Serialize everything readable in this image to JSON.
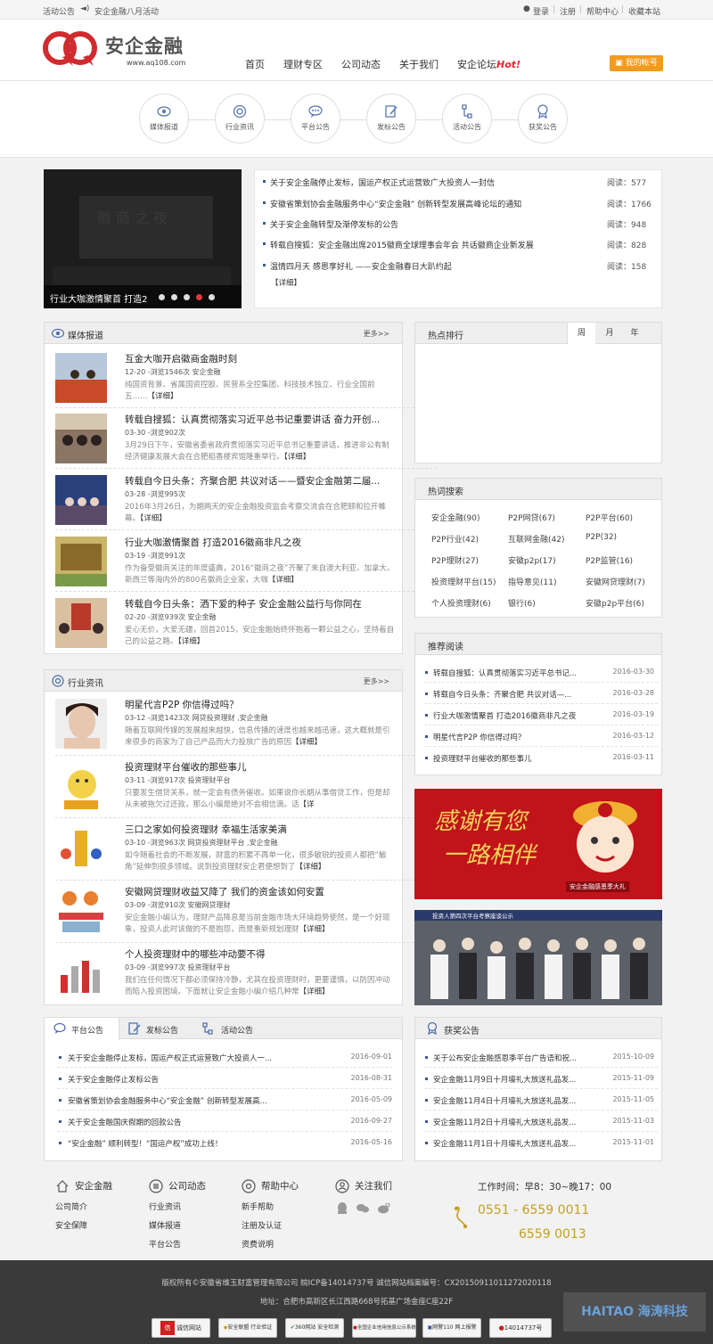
{
  "topbar": {
    "notice_label": "活动公告",
    "notice_text": "安企金融八月活动",
    "login": "登录",
    "register": "注册",
    "help": "帮助中心",
    "favorite": "收藏本站"
  },
  "brand": {
    "name": "安企金融",
    "url": "www.aq108.com",
    "accent": "#d02b2f"
  },
  "nav": {
    "items": [
      "首页",
      "理财专区",
      "公司动态",
      "关于我们",
      "安企论坛"
    ],
    "hot": "Hot!",
    "account": "我的帐号"
  },
  "categories": [
    {
      "label": "媒体报道",
      "icon": "eye-icon"
    },
    {
      "label": "行业资讯",
      "icon": "target-icon"
    },
    {
      "label": "平台公告",
      "icon": "chat-icon"
    },
    {
      "label": "发标公告",
      "icon": "edit-icon"
    },
    {
      "label": "活动公告",
      "icon": "flow-icon"
    },
    {
      "label": "获奖公告",
      "icon": "medal-icon"
    }
  ],
  "slider": {
    "caption": "行业大咖激情聚首 打造2",
    "dots": 5,
    "active_dot": 4
  },
  "top_news": {
    "items": [
      {
        "title": "关于安企金融停止发标，国运产权正式运营致广大投资人一封信",
        "views": "阅读：577"
      },
      {
        "title": "安徽省策划协会金融服务中心“安企金融” 创新转型发展高峰论坛的通知",
        "views": "阅读：1766"
      },
      {
        "title": "关于安企金融转型及渐停发标的公告",
        "views": "阅读：948"
      },
      {
        "title": "转载自搜狐：安企金融出席2015徽商全球理事会年会 共话徽商企业新发展",
        "views": "阅读：828"
      },
      {
        "title": "温情四月天 感恩享好礼 ——安企金融春日大趴约起",
        "views": "阅读：158"
      }
    ],
    "detail": "【详细】"
  },
  "media": {
    "title": "媒体报道",
    "more": "更多>>",
    "items": [
      {
        "title": "互金大咖开启徽商金融时刻",
        "meta": "12-20 -浏览1546次 安企金融",
        "desc": "纯国资背景、省属国资控股、民营系全控集团、科技技术独立、行业全国前五……",
        "more": "【详细】"
      },
      {
        "title": "转载自搜狐：认真贯彻落实习近平总书记重要讲话 奋力开创...",
        "meta": "03-30 -浏览902次",
        "desc": "3月29日下午，安徽省委省政府贯彻落实习近平总书记重要讲话，推进非公有制经济健康发展大会在合肥稻香楼宾馆隆重举行。",
        "more": "【详细】"
      },
      {
        "title": "转载自今日头条：齐聚合肥 共议对话——暨安企金融第二届...",
        "meta": "03-28 -浏览995次",
        "desc": "2016年3月26日，为期两天的安企金融投资监会考察交流会在合肥颐和拉开帷幕。",
        "more": "【详细】"
      },
      {
        "title": "行业大咖激情聚首 打造2016徽商非凡之夜",
        "meta": "03-19 -浏览991次",
        "desc": "作为备受徽商关注的年度盛典，2016“徽商之夜”齐聚了来自澳大利亚、加拿大、新西兰等海内外的800名徽商企业家，大咖",
        "more": "【详细】"
      },
      {
        "title": "转载自今日头条：洒下爱的种子 安企金融公益行与你同在",
        "meta": "02-20 -浏览939次 安企金融",
        "desc": "爱心无价，大爱无疆，回首2015，安企金融始终怀抱着一颗公益之心，坚持着自己的公益之路。",
        "more": "【详细】"
      }
    ]
  },
  "industry": {
    "title": "行业资讯",
    "more": "更多>>",
    "items": [
      {
        "title": "明星代言P2P 你信得过吗？",
        "meta": "03-12 -浏览1423次 网贷投资理财 ,安企金融",
        "desc": "随着互联网传媒的发展越来越快，信息传播的速度也越来越迅速，这大概就是引来很多的商家为了自己产品而大力投放广告的原因",
        "more": "【详细】"
      },
      {
        "title": "投资理财平台催收的那些事儿",
        "meta": "03-11 -浏览917次 投资理财平台",
        "desc": "只要发生借贷关系，就一定会有债务催收。如果说你长期从事借贷工作，但是却从未被拖欠过还款，那么小编是绝对不会相信滴。话",
        "more": "【详"
      },
      {
        "title": "三口之家如何投资理财 幸福生活家美满",
        "meta": "03-10 -浏览963次 网贷投资理财平台 ,安企金融",
        "desc": "如今随着社会的不断发展，财富的积累不再单一化，很多敏锐的投资人都把“触角”延伸到很多领域。说到投资理财安企君便想到了",
        "more": "【详细】"
      },
      {
        "title": "安徽网贷理财收益又降了 我们的资金该如何安置",
        "meta": "03-09 -浏览910次 安徽网贷理财",
        "desc": "安企金融小编认为，理财产品降息是当前金融市场大环境趋势使然，是一个好现象，投资人此时该做的不是抱怨，而是重新规划理财",
        "more": "【详细】"
      },
      {
        "title": "个人投资理财中的哪些冲动要不得",
        "meta": "03-09 -浏览997次 投资理财平台",
        "desc": "我们在任何情况下都必须保持冷静，尤其在投资理财时，更要谨慎，以防因冲动而陷入投资困境。下面就让安企金融小编介绍几种常",
        "more": "【详细】"
      }
    ]
  },
  "hot_rank": {
    "title": "热点排行",
    "tabs": [
      "周",
      "月",
      "年"
    ]
  },
  "hot_search": {
    "title": "热词搜索",
    "keywords": [
      [
        "安企金融(90)",
        "P2P网贷(67)",
        "P2P平台(60)"
      ],
      [
        "P2P行业(42)",
        "互联网金融(42)",
        "P2P(32)"
      ],
      [
        "P2P理财(27)",
        "安徽p2p(17)",
        "P2P监管(16)"
      ],
      [
        "投资理财平台(15)",
        "指导意见(11)",
        "安徽网贷理财(7)"
      ],
      [
        "个人投资理财(6)",
        "银行(6)",
        "安徽p2p平台(6)"
      ]
    ]
  },
  "recommend": {
    "title": "推荐阅读",
    "items": [
      {
        "title": "转载自搜狐：认真贯彻落实习近平总书记...",
        "date": "2016-03-30"
      },
      {
        "title": "转载自今日头条：齐聚合肥 共议对话—...",
        "date": "2016-03-28"
      },
      {
        "title": "行业大咖激情聚首 打造2016徽商非凡之夜",
        "date": "2016-03-19"
      },
      {
        "title": "明星代言P2P 你信得过吗？",
        "date": "2016-03-12"
      },
      {
        "title": "投资理财平台催收的那些事儿",
        "date": "2016-03-11"
      }
    ]
  },
  "banner1": {
    "line1": "感谢有您",
    "line2": "一路相伴",
    "badge": "安企金融感恩季大礼"
  },
  "banner2": {
    "caption": "投资人第四次平台考察座谈公示"
  },
  "announce": {
    "tabs": [
      "平台公告",
      "发标公告",
      "活动公告"
    ],
    "items": [
      {
        "title": "关于安企金融停止发标，国运产权正式运营致广大投资人一...",
        "date": "2016-09-01"
      },
      {
        "title": "关于安企金融停止发标公告",
        "date": "2016-08-31"
      },
      {
        "title": "安徽省策划协会金融服务中心“安企金融” 创新转型发展高...",
        "date": "2016-05-09"
      },
      {
        "title": "关于安企金融国庆假期的回款公告",
        "date": "2016-09-27"
      },
      {
        "title": "“安企金融” 顺利转型！“国运产权”成功上线！",
        "date": "2016-05-16"
      }
    ]
  },
  "awards": {
    "title": "获奖公告",
    "items": [
      {
        "title": "关于公布安企金融感恩季平台广告语和祝...",
        "date": "2015-10-09"
      },
      {
        "title": "安企金融11月9日十月壕礼大放送礼品发...",
        "date": "2015-11-09"
      },
      {
        "title": "安企金融11月4日十月壕礼大放送礼品发...",
        "date": "2015-11-05"
      },
      {
        "title": "安企金融11月2日十月壕礼大放送礼品发...",
        "date": "2015-11-03"
      },
      {
        "title": "安企金融11月1日十月壕礼大放送礼品发...",
        "date": "2015-11-01"
      }
    ]
  },
  "footer_links": [
    {
      "title": "安企金融",
      "links": [
        "公司简介",
        "安全保障"
      ]
    },
    {
      "title": "公司动态",
      "links": [
        "行业资讯",
        "媒体报道",
        "平台公告"
      ]
    },
    {
      "title": "帮助中心",
      "links": [
        "新手帮助",
        "注册及认证",
        "资费说明"
      ]
    },
    {
      "title": "关注我们",
      "links": []
    }
  ],
  "contact": {
    "hours": "工作时间：早8：30~晚17：00",
    "phone1": "0551 - 6559 0011",
    "phone2": "6559 0013"
  },
  "footer": {
    "copyright": "版权所有©安徽省维玉财富管理有限公司 皖ICP备14014737号 诚信网站档案编号：CX20150911011272020118",
    "address": "地址：合肥市高新区长江西路668号拓基广场金座C座22F",
    "badges": [
      "诚信网站",
      "安全联盟 行业验证",
      "360网站 安全检测",
      "全国企业信用信息公示系统",
      "网警110 网上报警",
      "14014737号"
    ],
    "watermark": "HAITAO 海涛科技"
  }
}
